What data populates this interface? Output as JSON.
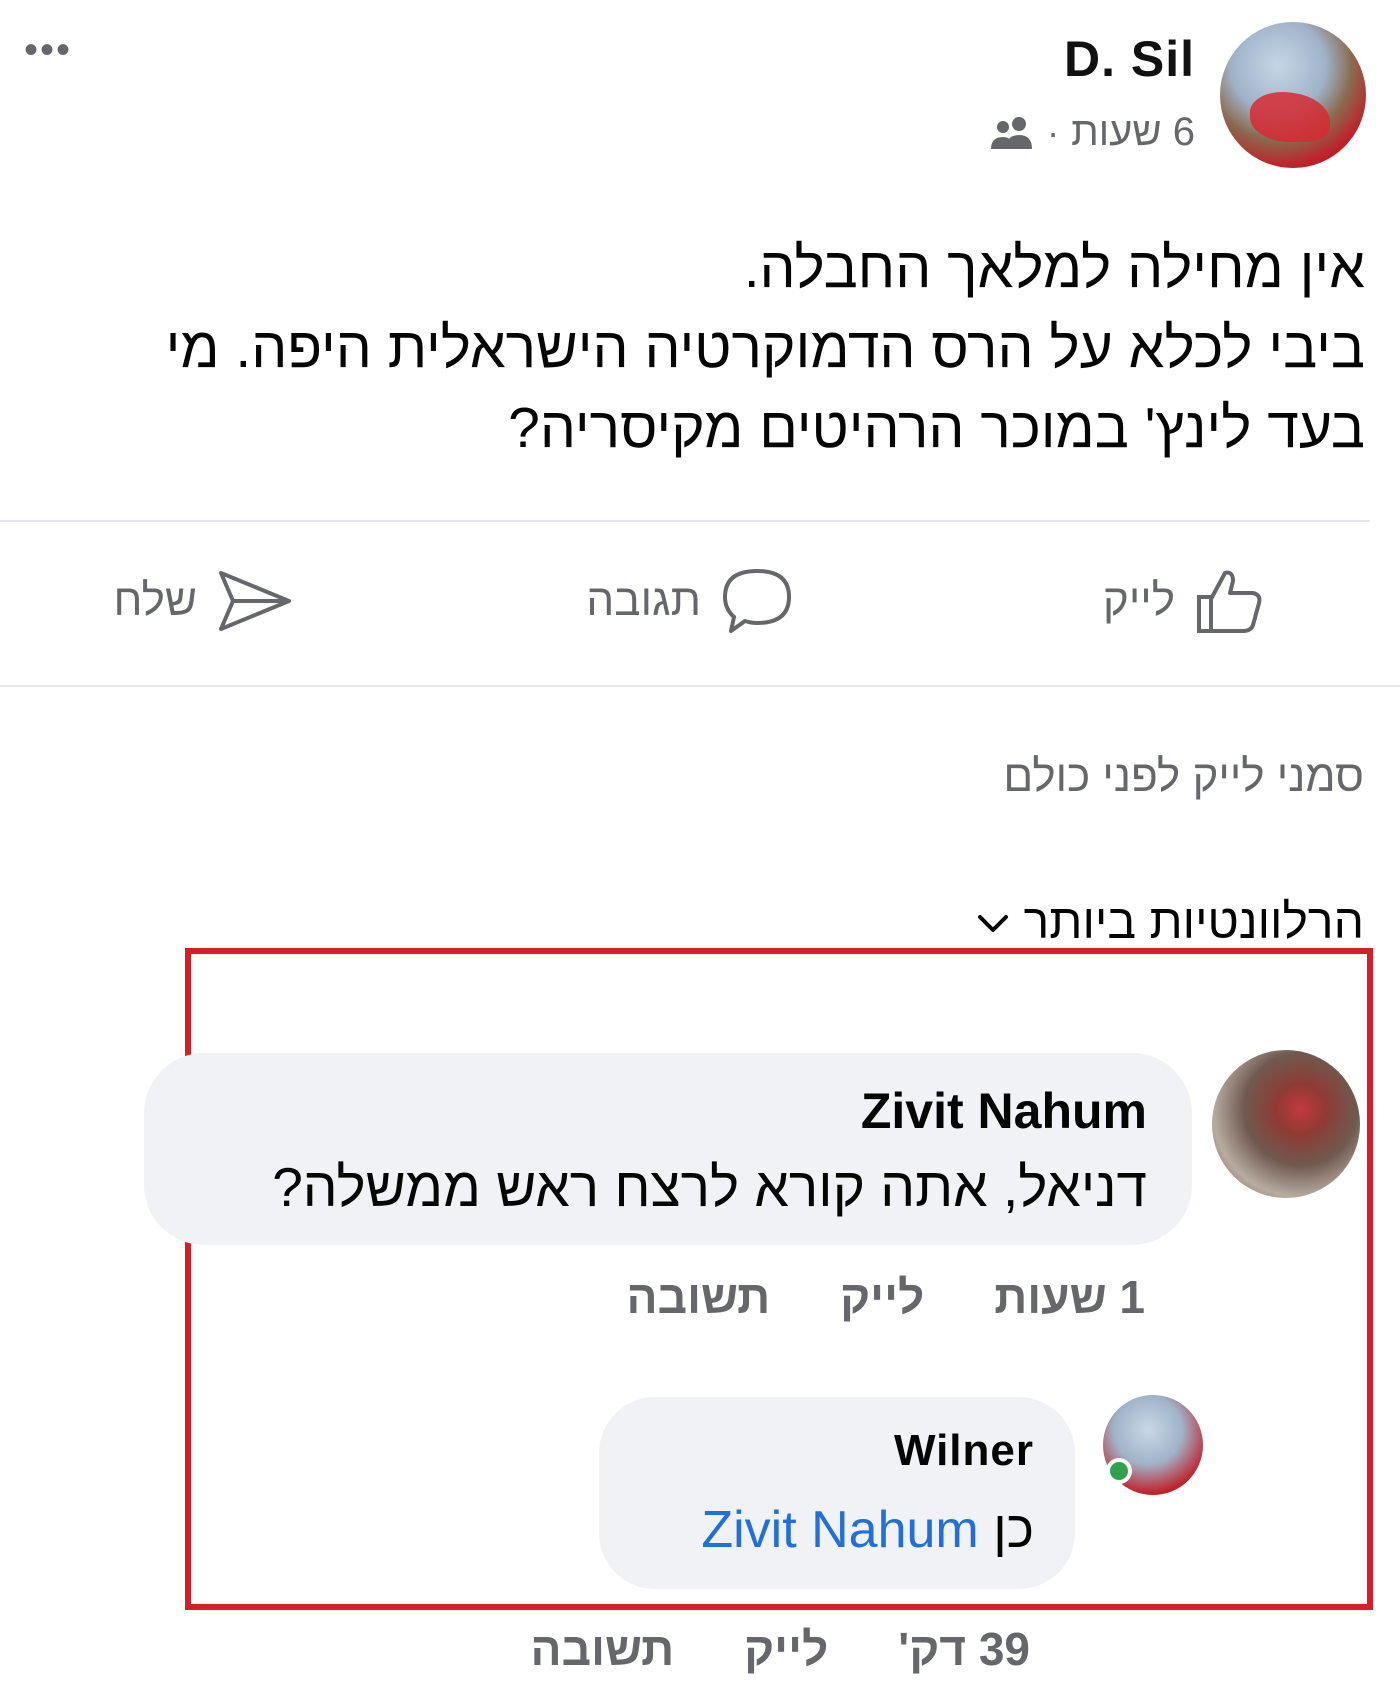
{
  "post": {
    "author": "D. Sil",
    "time": "6 שעות",
    "separator": "·",
    "text_lines": [
      "אין מחילה למלאך החבלה.",
      "ביבי לכלא על הרס הדמוקרטיה הישראלית היפה. מי",
      "בעד לינץ' במוכר הרהיטים מקיסריה?"
    ]
  },
  "actions": {
    "like": "לייק",
    "comment": "תגובה",
    "share": "שלח"
  },
  "first_like_prompt": "סמני לייק לפני כולם",
  "sort": {
    "label": "הרלוונטיות ביותר"
  },
  "comments": [
    {
      "name": "Zivit Nahum",
      "text": "דניאל, אתה קורא לרצח ראש ממשלה?",
      "time": "1 שעות",
      "like": "לייק",
      "reply": "תשובה"
    }
  ],
  "reply": {
    "name": "Wilner",
    "prefix": "כן",
    "mention": "Zivit Nahum",
    "time": "39 דק'",
    "like": "לייק",
    "reply": "תשובה"
  },
  "colors": {
    "highlight": "#d61e26",
    "mention": "#216fdb",
    "online": "#31a24c",
    "secondary_text": "#65676b",
    "bubble": "#f0f2f5"
  }
}
